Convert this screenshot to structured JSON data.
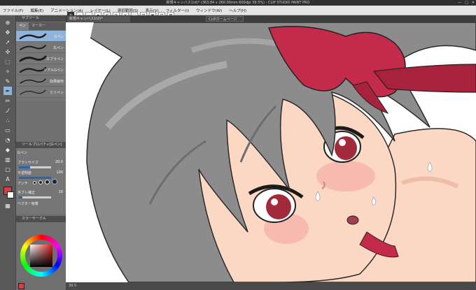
{
  "window": {
    "title": "新規キャンバス1(d)* (363.84 x 260.00mm 600dpi 39.5%) - CLIP STUDIO PAINT PRO",
    "controls": [
      "—",
      "□",
      "✕"
    ]
  },
  "menu": [
    "ファイル(F)",
    "編集(E)",
    "アニメーション(A)",
    "レイヤー(L)",
    "選択範囲(S)",
    "表示(V)",
    "フィルター(I)",
    "ウィンドウ(W)",
    "ヘルプ(H)"
  ],
  "doc_tabs": {
    "active": "新規キャンバス1(d)*",
    "other": "CLIPホームページ"
  },
  "subtool": {
    "header": "サブツール",
    "tabs": [
      "ペン",
      "マーカー"
    ],
    "brushes": [
      {
        "name": "Gペン",
        "selected": true
      },
      {
        "name": "丸ペン",
        "selected": false
      },
      {
        "name": "カブラペン",
        "selected": false
      },
      {
        "name": "リアルGペン",
        "selected": false
      },
      {
        "name": "効果線用",
        "selected": false
      },
      {
        "name": "ミリペン",
        "selected": false
      }
    ]
  },
  "tool_props": {
    "header": "ツールプロパティ[Gペン]",
    "label_name": "Gペン",
    "brush_size_label": "ブラシサイズ",
    "brush_size_value": "20.0",
    "brush_size_fraction": 0.35,
    "opacity_label": "不透明度",
    "opacity_value": "100",
    "opacity_fraction": 1.0,
    "aa_label": "アンチ",
    "stabilize_label": "手ブレ補正",
    "stabilize_value": "10",
    "stabilize_fraction": 0.1,
    "vector_label": "ベクター吸着"
  },
  "color_wheel": {
    "header": "カラーサークル"
  },
  "colors": {
    "foreground": "#d83b4a",
    "background": "#ffffff",
    "accent": "#8fb3d9",
    "hair": "#8c8c8c",
    "skin": "#fbd7c4",
    "ribbon": "#c42b4a",
    "eye": "#a32a3a"
  },
  "status": {
    "zoom": "39.5"
  }
}
